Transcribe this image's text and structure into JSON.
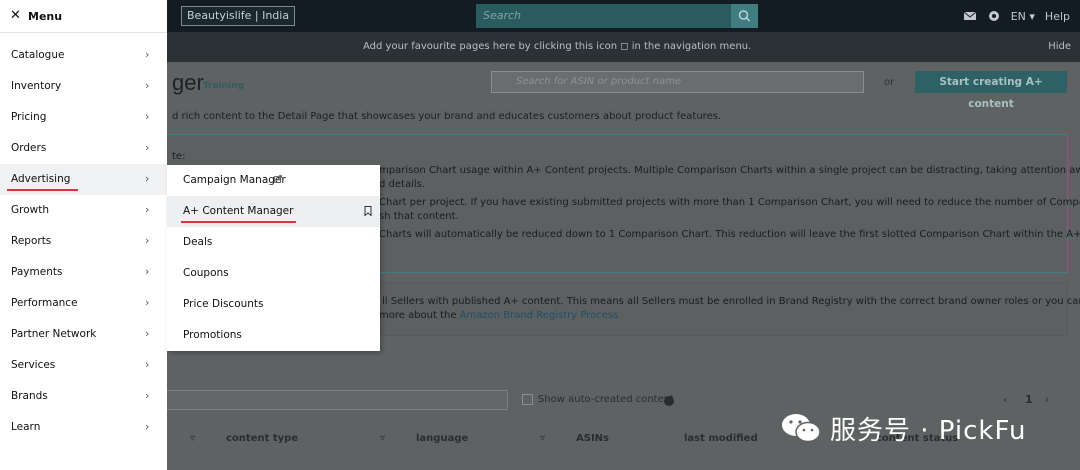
{
  "topbar": {
    "store": "Beautyislife | India",
    "search_placeholder": "Search",
    "language": "EN",
    "help": "Help"
  },
  "infobar": {
    "message": "Add your favourite pages here by clicking this icon ◻ in the navigation menu.",
    "hide": "Hide"
  },
  "page": {
    "title_fragment": "ger",
    "training": "Training",
    "asin_placeholder": "Search for ASIN or product name",
    "or": "or",
    "start_button": "Start creating A+ content",
    "intro": "d rich content to the Detail Page that showcases your brand and educates customers about product features."
  },
  "notice1": {
    "lines": [
      "te:",
      "mparison Chart usage within A+ Content projects. Multiple Comparison Charts within a single project can be distracting, taking attention away from",
      "d details.",
      "Chart per project. If you have existing submitted projects with more than 1 Comparison Chart, you will need to reduce the number of Comparison",
      "sh that content.",
      "Charts will automatically be reduced down to 1 Comparison Chart. This reduction will leave the first slotted Comparison Chart within the A+ content"
    ]
  },
  "notice2": {
    "line1": "ll Sellers with published A+ content. This means all Sellers must be enrolled in Brand Registry with the correct brand owner roles or you can lose",
    "line2_prefix": "more about the ",
    "line2_link": "Amazon Brand Registry Process"
  },
  "table": {
    "show_auto_label": "Show auto-created content",
    "page_number": "1",
    "headers": [
      "content type",
      "language",
      "ASINs",
      "last modified",
      "content status"
    ]
  },
  "menu": {
    "title": "Menu",
    "items": [
      {
        "label": "Catalogue"
      },
      {
        "label": "Inventory"
      },
      {
        "label": "Pricing"
      },
      {
        "label": "Orders"
      },
      {
        "label": "Advertising"
      },
      {
        "label": "Growth"
      },
      {
        "label": "Reports"
      },
      {
        "label": "Payments"
      },
      {
        "label": "Performance"
      },
      {
        "label": "Partner Network"
      },
      {
        "label": "Services"
      },
      {
        "label": "Brands"
      },
      {
        "label": "Learn"
      }
    ]
  },
  "submenu": {
    "items": [
      {
        "label": "Campaign Manager"
      },
      {
        "label": "A+ Content Manager"
      },
      {
        "label": "Deals"
      },
      {
        "label": "Coupons"
      },
      {
        "label": "Price Discounts"
      },
      {
        "label": "Promotions"
      }
    ]
  },
  "watermark": {
    "text": "服务号 · PickFu"
  },
  "colors": {
    "accent_underline": "#e0323f",
    "teal_button": "#2e6165"
  }
}
